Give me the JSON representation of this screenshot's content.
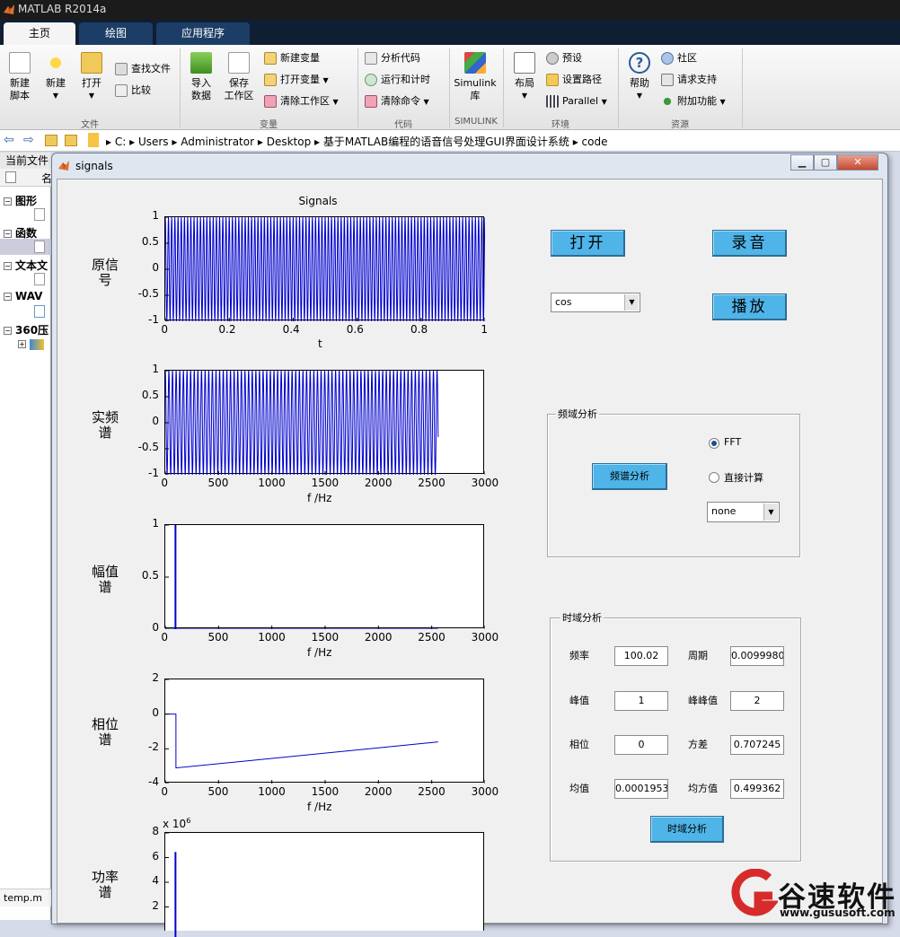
{
  "app": {
    "title": "MATLAB R2014a"
  },
  "ribbon_tabs": [
    "主页",
    "绘图",
    "应用程序"
  ],
  "ribbon": {
    "file": {
      "new_script": "新建\n脚本",
      "new": "新建",
      "open": "打开",
      "find_files": "查找文件",
      "compare": "比较",
      "section": "文件"
    },
    "variable": {
      "import": "导入\n数据",
      "save": "保存\n工作区",
      "new_var": "新建变量",
      "open_var": "打开变量",
      "clear_ws": "清除工作区",
      "section": "变量"
    },
    "code": {
      "analyze": "分析代码",
      "run_time": "运行和计时",
      "clear_cmd": "清除命令",
      "section": "代码"
    },
    "simulink": {
      "lib": "Simulink\n库",
      "section": "SIMULINK"
    },
    "env": {
      "layout": "布局",
      "prefs": "预设",
      "set_path": "设置路径",
      "parallel": "Parallel",
      "section": "环境"
    },
    "resources": {
      "help": "帮助",
      "community": "社区",
      "support": "请求支持",
      "addons": "附加功能",
      "section": "资源"
    }
  },
  "address": [
    "C:",
    "Users",
    "Administrator",
    "Desktop",
    "基于MATLAB编程的语音信号处理GUI界面设计系统",
    "code"
  ],
  "left_panel": {
    "header": "当前文件",
    "col": "名",
    "groups": [
      "图形",
      "函数",
      "文本文",
      "WAV",
      "360压"
    ],
    "bottom": "temp.m"
  },
  "figure": {
    "title": "signals",
    "plot_title": "Signals",
    "axes": [
      {
        "label": "原信\n号",
        "xlabel": "t",
        "yticks": [
          "1",
          "0.5",
          "0",
          "-0.5",
          "-1"
        ],
        "xticks": [
          "0",
          "0.2",
          "0.4",
          "0.6",
          "0.8",
          "1"
        ]
      },
      {
        "label": "实频\n谱",
        "xlabel": "f /Hz",
        "yticks": [
          "1",
          "0.5",
          "0",
          "-0.5",
          "-1"
        ],
        "xticks": [
          "0",
          "500",
          "1000",
          "1500",
          "2000",
          "2500",
          "3000"
        ]
      },
      {
        "label": "幅值\n谱",
        "xlabel": "f /Hz",
        "yticks": [
          "1",
          "0.5",
          "0"
        ],
        "xticks": [
          "0",
          "500",
          "1000",
          "1500",
          "2000",
          "2500",
          "3000"
        ]
      },
      {
        "label": "相位\n谱",
        "xlabel": "f /Hz",
        "yticks": [
          "2",
          "0",
          "-2",
          "-4"
        ],
        "xticks": [
          "0",
          "500",
          "1000",
          "1500",
          "2000",
          "2500",
          "3000"
        ]
      },
      {
        "label": "功率\n谱",
        "exponent": "x 10",
        "exponent_sup": "6",
        "yticks": [
          "8",
          "6",
          "4",
          "2"
        ]
      }
    ],
    "buttons": {
      "open": "打开",
      "record": "录音",
      "play": "播放",
      "spectrum": "频谱分析",
      "time_analysis": "时域分析"
    },
    "signal_popup": "cos",
    "freq_group": {
      "title": "频域分析",
      "fft": "FFT",
      "direct": "直接计算",
      "popup": "none",
      "selected": "FFT"
    },
    "time_group": {
      "title": "时域分析",
      "fields": [
        {
          "label": "频率",
          "value": "100.02"
        },
        {
          "label": "周期",
          "value": "0.00999805"
        },
        {
          "label": "峰值",
          "value": "1"
        },
        {
          "label": "峰峰值",
          "value": "2"
        },
        {
          "label": "相位",
          "value": "0"
        },
        {
          "label": "方差",
          "value": "0.707245"
        },
        {
          "label": "均值",
          "value": "0.00019531"
        },
        {
          "label": "均方值",
          "value": "0.499362"
        }
      ]
    }
  },
  "watermark": {
    "brand": "谷速软件",
    "url": "www.gususoft.com"
  },
  "chart_data": [
    {
      "type": "line",
      "title": "Signals",
      "xlabel": "t",
      "ylabel": "原信号",
      "xlim": [
        0,
        1
      ],
      "ylim": [
        -1,
        1
      ],
      "series": [
        {
          "formula": "cos(2*pi*100*t)",
          "freq_hz": 100
        }
      ]
    },
    {
      "type": "line",
      "xlabel": "f /Hz",
      "ylabel": "实频谱",
      "xlim": [
        0,
        3000
      ],
      "ylim": [
        -1,
        1
      ],
      "x_end": 2560
    },
    {
      "type": "line",
      "xlabel": "f /Hz",
      "ylabel": "幅值谱",
      "xlim": [
        0,
        3000
      ],
      "ylim": [
        0,
        1
      ],
      "peak": {
        "x": 100,
        "y": 1
      },
      "x_end": 2560
    },
    {
      "type": "line",
      "xlabel": "f /Hz",
      "ylabel": "相位谱",
      "xlim": [
        0,
        3000
      ],
      "ylim": [
        -4,
        2
      ],
      "x": [
        0,
        100,
        100,
        2560
      ],
      "y": [
        0,
        0,
        -3.1,
        -1.6
      ]
    },
    {
      "type": "line",
      "ylabel": "功率谱",
      "ylim": [
        0,
        8
      ],
      "y_multiplier": "10^6",
      "peak": {
        "x": 100,
        "y": 6.5
      }
    }
  ]
}
